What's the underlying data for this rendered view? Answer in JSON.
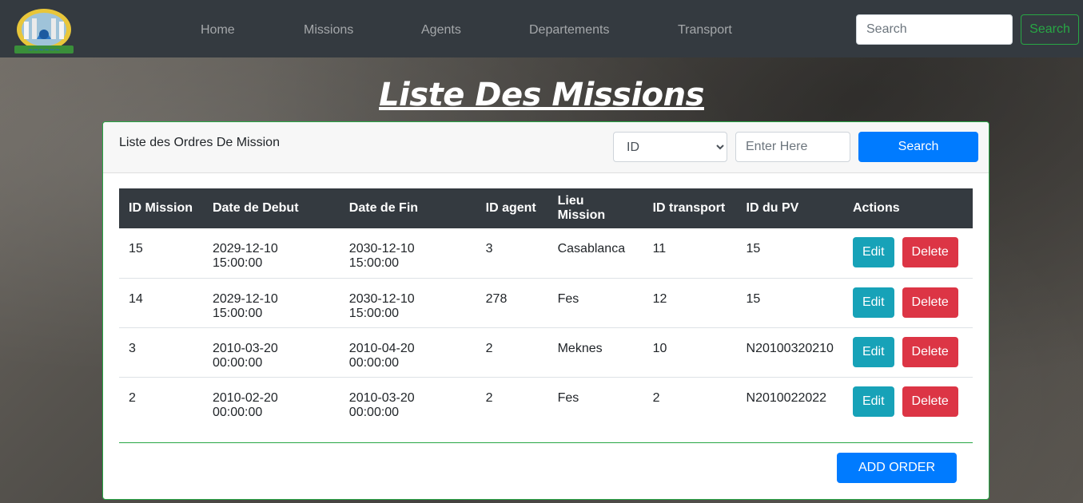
{
  "nav": {
    "links": [
      "Home",
      "Missions",
      "Agents",
      "Departements",
      "Transport"
    ],
    "search_placeholder": "Search",
    "search_button": "Search"
  },
  "page": {
    "title": "Liste Des Missions"
  },
  "card": {
    "header_title": "Liste des Ordres De Mission",
    "filter": {
      "selected": "ID",
      "input_placeholder": "Enter Here",
      "button": "Search"
    },
    "table": {
      "columns": [
        "ID Mission",
        "Date de Debut",
        "Date de Fin",
        "ID agent",
        "Lieu Mission",
        "ID transport",
        "ID du PV",
        "Actions"
      ],
      "rows": [
        [
          "15",
          "2029-12-10 15:00:00",
          "2030-12-10 15:00:00",
          "3",
          "Casablanca",
          "11",
          "15"
        ],
        [
          "14",
          "2029-12-10 15:00:00",
          "2030-12-10 15:00:00",
          "278",
          "Fes",
          "12",
          "15"
        ],
        [
          "3",
          "2010-03-20 00:00:00",
          "2010-04-20 00:00:00",
          "2",
          "Meknes",
          "10",
          "N20100320210"
        ],
        [
          "2",
          "2010-02-20 00:00:00",
          "2010-03-20 00:00:00",
          "2",
          "Fes",
          "2",
          "N2010022022"
        ]
      ],
      "edit_label": "Edit",
      "delete_label": "Delete"
    },
    "add_button": "ADD ORDER"
  }
}
